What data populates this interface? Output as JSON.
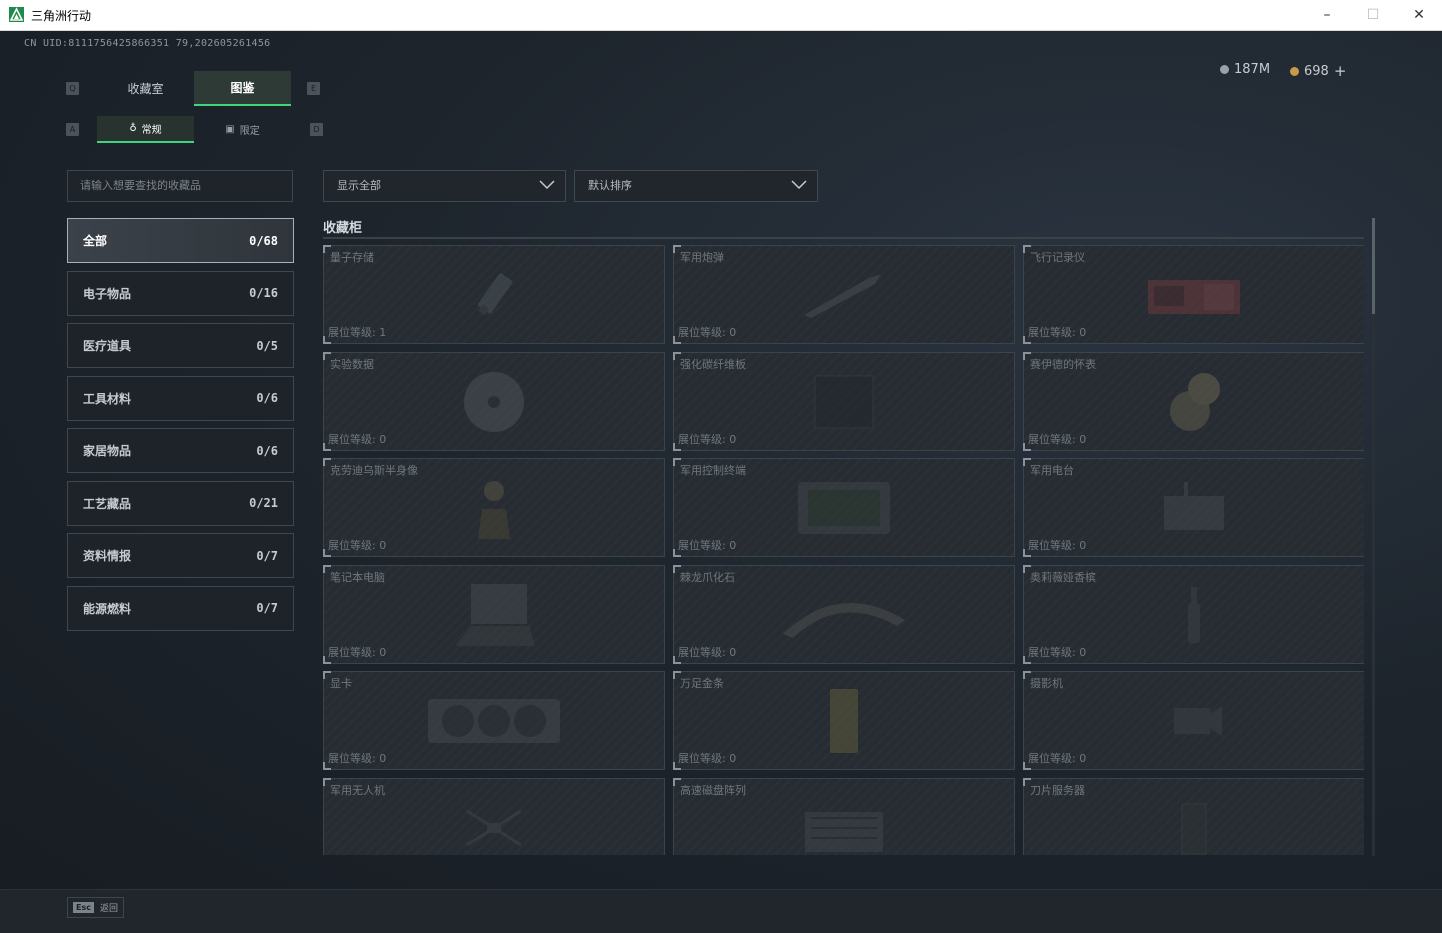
{
  "window": {
    "title": "三角洲行动",
    "minimize": "–",
    "maximize": "☐",
    "close": "✕"
  },
  "header": {
    "uid": "CN UID:8111756425866351 79,202605261456",
    "currency_a": "187M",
    "currency_b": "698",
    "add_label": "+"
  },
  "tabs": {
    "left_key": "Q",
    "right_key": "E",
    "items": [
      {
        "label": "收藏室"
      },
      {
        "label": "图鉴"
      }
    ]
  },
  "subtabs": {
    "left_key": "A",
    "right_key": "D",
    "items": [
      {
        "label": "常规"
      },
      {
        "label": "限定"
      }
    ]
  },
  "search": {
    "placeholder": "请输入想要查找的收藏品"
  },
  "categories": [
    {
      "label": "全部",
      "count": "0/68"
    },
    {
      "label": "电子物品",
      "count": "0/16"
    },
    {
      "label": "医疗道具",
      "count": "0/5"
    },
    {
      "label": "工具材料",
      "count": "0/6"
    },
    {
      "label": "家居物品",
      "count": "0/6"
    },
    {
      "label": "工艺藏品",
      "count": "0/21"
    },
    {
      "label": "资料情报",
      "count": "0/7"
    },
    {
      "label": "能源燃料",
      "count": "0/7"
    }
  ],
  "filters": {
    "show": "显示全部",
    "sort": "默认排序"
  },
  "section": {
    "title": "收藏柜"
  },
  "items": [
    {
      "name": "量子存储",
      "level": "展位等级: 1"
    },
    {
      "name": "军用炮弹",
      "level": "展位等级: 0"
    },
    {
      "name": "飞行记录仪",
      "level": "展位等级: 0"
    },
    {
      "name": "实验数据",
      "level": "展位等级: 0"
    },
    {
      "name": "强化碳纤维板",
      "level": "展位等级: 0"
    },
    {
      "name": "赛伊德的怀表",
      "level": "展位等级: 0"
    },
    {
      "name": "克劳迪乌斯半身像",
      "level": "展位等级: 0"
    },
    {
      "name": "军用控制终端",
      "level": "展位等级: 0"
    },
    {
      "name": "军用电台",
      "level": "展位等级: 0"
    },
    {
      "name": "笔记本电脑",
      "level": "展位等级: 0"
    },
    {
      "name": "棘龙爪化石",
      "level": "展位等级: 0"
    },
    {
      "name": "奥莉薇娅香槟",
      "level": "展位等级: 0"
    },
    {
      "name": "显卡",
      "level": "展位等级: 0"
    },
    {
      "name": "万足金条",
      "level": "展位等级: 0"
    },
    {
      "name": "摄影机",
      "level": "展位等级: 0"
    },
    {
      "name": "军用无人机",
      "level": ""
    },
    {
      "name": "高速磁盘阵列",
      "level": ""
    },
    {
      "name": "刀片服务器",
      "level": ""
    }
  ],
  "footer": {
    "esc_key": "Esc",
    "back_label": "返回"
  },
  "colors": {
    "accent": "#3fd67e",
    "background": "#1b2128"
  }
}
